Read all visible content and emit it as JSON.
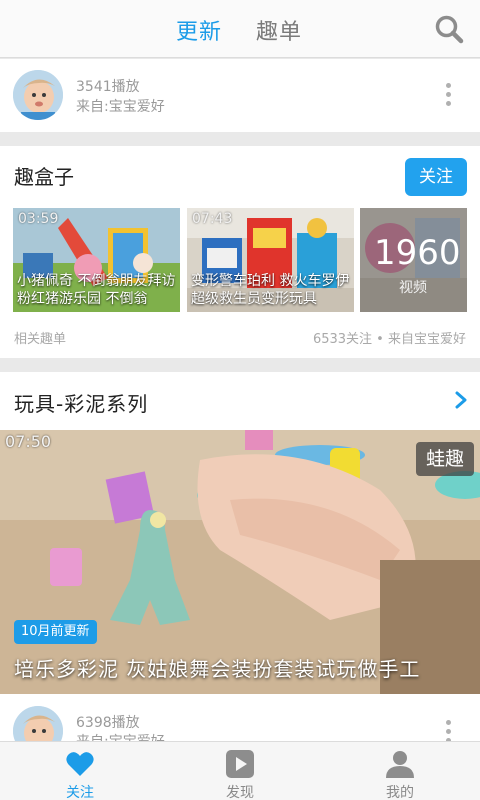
{
  "topbar": {
    "tabs": [
      {
        "label": "更新",
        "active": true
      },
      {
        "label": "趣单",
        "active": false
      }
    ],
    "search_icon": "search-icon"
  },
  "author_card_1": {
    "plays": "3541播放",
    "source": "来自:宝宝爱好"
  },
  "fun_box": {
    "title": "趣盒子",
    "follow_label": "关注",
    "videos": [
      {
        "duration": "03:59",
        "caption": "小猪佩奇 不倒翁朋友拜访粉红猪游乐园 不倒翁"
      },
      {
        "duration": "07:43",
        "caption": "变形警车珀利 救火车罗伊 超级救生员变形玩具"
      }
    ],
    "count": "1960",
    "count_label": "视频",
    "related_label": "相关趣单",
    "stats": "6533关注 • 来自宝宝爱好"
  },
  "series": {
    "title": "玩具-彩泥系列",
    "duration": "07:50",
    "channel": "蛙趣",
    "updated": "10月前更新",
    "video_title": "培乐多彩泥 灰姑娘舞会装扮套装试玩做手工"
  },
  "author_card_2": {
    "plays": "6398播放",
    "source": "来自:宝宝爱好"
  },
  "bottom_nav": {
    "items": [
      {
        "label": "关注",
        "icon": "heart-icon",
        "active": true
      },
      {
        "label": "发现",
        "icon": "play-icon",
        "active": false
      },
      {
        "label": "我的",
        "icon": "person-icon",
        "active": false
      }
    ]
  },
  "colors": {
    "accent": "#1c9ce8",
    "follow_button": "#22a2ee"
  }
}
